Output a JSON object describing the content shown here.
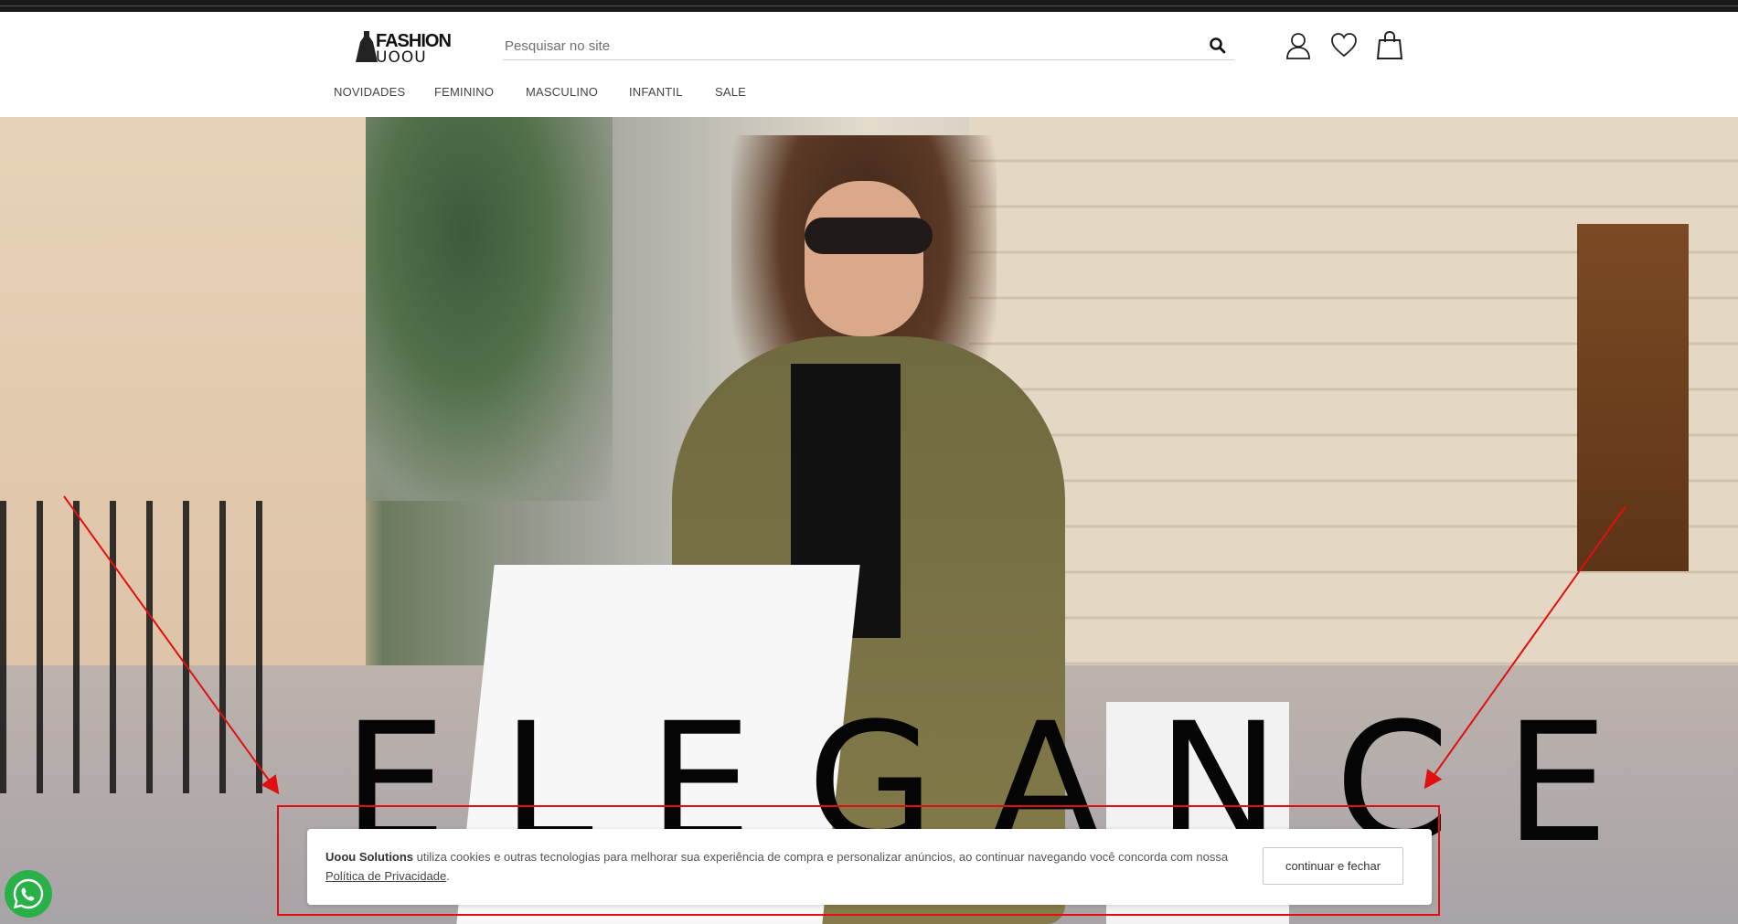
{
  "header": {
    "logo": {
      "line1": "FASHION",
      "line2": "UOOU",
      "icon": "dress-icon"
    },
    "search": {
      "placeholder": "Pesquisar no site",
      "value": "",
      "icon": "search-icon"
    },
    "icons": [
      "user-icon",
      "heart-icon",
      "shopping-bag-icon"
    ]
  },
  "nav": {
    "items": [
      {
        "label": "NOVIDADES"
      },
      {
        "label": "FEMININO"
      },
      {
        "label": "MASCULINO"
      },
      {
        "label": "INFANTIL"
      },
      {
        "label": "SALE"
      }
    ]
  },
  "hero": {
    "headline": "ELEGANCE"
  },
  "cookie": {
    "brand": "Uoou Solutions",
    "text": " utiliza cookies e outras tecnologias para melhorar sua experiência de compra e personalizar anúncios, ao continuar navegando você concorda com nossa ",
    "policy_link": "Política de Privacidade",
    "end": ".",
    "button_label": "continuar e fechar"
  },
  "colors": {
    "annotation": "#e01010",
    "whatsapp": "#2ab048",
    "topbar": "#1a1a1a"
  },
  "floating": {
    "whatsapp_icon": "whatsapp-icon"
  }
}
